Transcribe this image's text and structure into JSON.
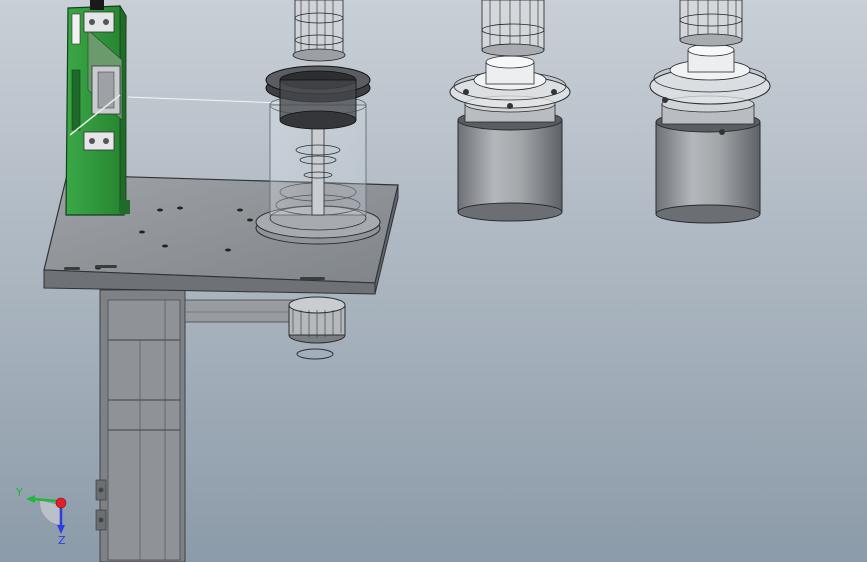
{
  "viewport": {
    "background_top": "#c9cfd6",
    "background_bottom": "#8c9ba9"
  },
  "triad": {
    "y_label": "Y",
    "z_label": "Z",
    "y_color": "#1fb83a",
    "z_color": "#2a3fe0",
    "x_color": "#e0212a"
  },
  "colors": {
    "bracket_green": "#2f9a3c",
    "plate_gray": "#8a8f94",
    "motor_gray": "#9c9fa4",
    "dark_gray": "#5b5e62"
  }
}
